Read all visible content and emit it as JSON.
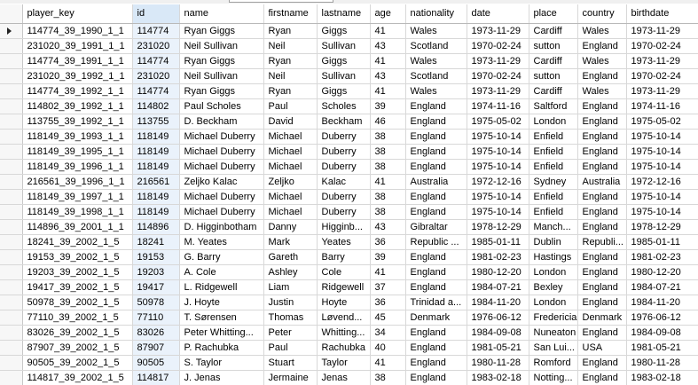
{
  "columns": [
    "player_key",
    "id",
    "name",
    "firstname",
    "lastname",
    "age",
    "nationality",
    "date",
    "place",
    "country",
    "birthdate"
  ],
  "rows": [
    [
      "114774_39_1990_1_1",
      "114774",
      "Ryan  Giggs",
      "Ryan",
      "Giggs",
      "41",
      "Wales",
      "1973-11-29",
      "Cardiff",
      "Wales",
      "1973-11-29"
    ],
    [
      "231020_39_1991_1_1",
      "231020",
      "Neil Sullivan",
      "Neil",
      "Sullivan",
      "43",
      "Scotland",
      "1970-02-24",
      "sutton",
      "England",
      "1970-02-24"
    ],
    [
      "114774_39_1991_1_1",
      "114774",
      "Ryan  Giggs",
      "Ryan",
      "Giggs",
      "41",
      "Wales",
      "1973-11-29",
      "Cardiff",
      "Wales",
      "1973-11-29"
    ],
    [
      "231020_39_1992_1_1",
      "231020",
      "Neil Sullivan",
      "Neil",
      "Sullivan",
      "43",
      "Scotland",
      "1970-02-24",
      "sutton",
      "England",
      "1970-02-24"
    ],
    [
      "114774_39_1992_1_1",
      "114774",
      "Ryan  Giggs",
      "Ryan",
      "Giggs",
      "41",
      "Wales",
      "1973-11-29",
      "Cardiff",
      "Wales",
      "1973-11-29"
    ],
    [
      "114802_39_1992_1_1",
      "114802",
      "Paul Scholes",
      "Paul",
      "Scholes",
      "39",
      "England",
      "1974-11-16",
      "Saltford",
      "England",
      "1974-11-16"
    ],
    [
      "113755_39_1992_1_1",
      "113755",
      "D. Beckham",
      "David",
      "Beckham",
      "46",
      "England",
      "1975-05-02",
      "London",
      "England",
      "1975-05-02"
    ],
    [
      "118149_39_1993_1_1",
      "118149",
      "Michael Duberry",
      "Michael",
      "Duberry",
      "38",
      "England",
      "1975-10-14",
      "Enfield",
      "England",
      "1975-10-14"
    ],
    [
      "118149_39_1995_1_1",
      "118149",
      "Michael Duberry",
      "Michael",
      "Duberry",
      "38",
      "England",
      "1975-10-14",
      "Enfield",
      "England",
      "1975-10-14"
    ],
    [
      "118149_39_1996_1_1",
      "118149",
      "Michael Duberry",
      "Michael",
      "Duberry",
      "38",
      "England",
      "1975-10-14",
      "Enfield",
      "England",
      "1975-10-14"
    ],
    [
      "216561_39_1996_1_1",
      "216561",
      "Zeljko Kalac",
      "Zeljko",
      "Kalac",
      "41",
      "Australia",
      "1972-12-16",
      "Sydney",
      "Australia",
      "1972-12-16"
    ],
    [
      "118149_39_1997_1_1",
      "118149",
      "Michael Duberry",
      "Michael",
      "Duberry",
      "38",
      "England",
      "1975-10-14",
      "Enfield",
      "England",
      "1975-10-14"
    ],
    [
      "118149_39_1998_1_1",
      "118149",
      "Michael Duberry",
      "Michael",
      "Duberry",
      "38",
      "England",
      "1975-10-14",
      "Enfield",
      "England",
      "1975-10-14"
    ],
    [
      "114896_39_2001_1_1",
      "114896",
      "D. Higginbotham",
      "Danny",
      "Higginb...",
      "43",
      "Gibraltar",
      "1978-12-29",
      "Manch...",
      "England",
      "1978-12-29"
    ],
    [
      "18241_39_2002_1_5",
      "18241",
      "M. Yeates",
      "Mark",
      "Yeates",
      "36",
      "Republic ...",
      "1985-01-11",
      "Dublin",
      "Republi...",
      "1985-01-11"
    ],
    [
      "19153_39_2002_1_5",
      "19153",
      "G. Barry",
      "Gareth",
      "Barry",
      "39",
      "England",
      "1981-02-23",
      "Hastings",
      "England",
      "1981-02-23"
    ],
    [
      "19203_39_2002_1_5",
      "19203",
      "A. Cole",
      "Ashley",
      "Cole",
      "41",
      "England",
      "1980-12-20",
      "London",
      "England",
      "1980-12-20"
    ],
    [
      "19417_39_2002_1_5",
      "19417",
      "L. Ridgewell",
      "Liam",
      "Ridgewell",
      "37",
      "England",
      "1984-07-21",
      "Bexley",
      "England",
      "1984-07-21"
    ],
    [
      "50978_39_2002_1_5",
      "50978",
      "J. Hoyte",
      "Justin",
      "Hoyte",
      "36",
      "Trinidad a...",
      "1984-11-20",
      "London",
      "England",
      "1984-11-20"
    ],
    [
      "77110_39_2002_1_5",
      "77110",
      "T. Sørensen",
      "Thomas",
      "Løvend...",
      "45",
      "Denmark",
      "1976-06-12",
      "Fredericia",
      "Denmark",
      "1976-06-12"
    ],
    [
      "83026_39_2002_1_5",
      "83026",
      "Peter Whitting...",
      "Peter",
      "Whitting...",
      "34",
      "England",
      "1984-09-08",
      "Nuneaton",
      "England",
      "1984-09-08"
    ],
    [
      "87907_39_2002_1_5",
      "87907",
      "P. Rachubka",
      "Paul",
      "Rachubka",
      "40",
      "England",
      "1981-05-21",
      "San Lui...",
      "USA",
      "1981-05-21"
    ],
    [
      "90505_39_2002_1_5",
      "90505",
      "S. Taylor",
      "Stuart",
      "Taylor",
      "41",
      "England",
      "1980-11-28",
      "Romford",
      "England",
      "1980-11-28"
    ],
    [
      "114817_39_2002_1_5",
      "114817",
      "J. Jenas",
      "Jermaine",
      "Jenas",
      "38",
      "England",
      "1983-02-18",
      "Notting...",
      "England",
      "1983-02-18"
    ]
  ],
  "selected_column": "id",
  "current_row_index": 0
}
